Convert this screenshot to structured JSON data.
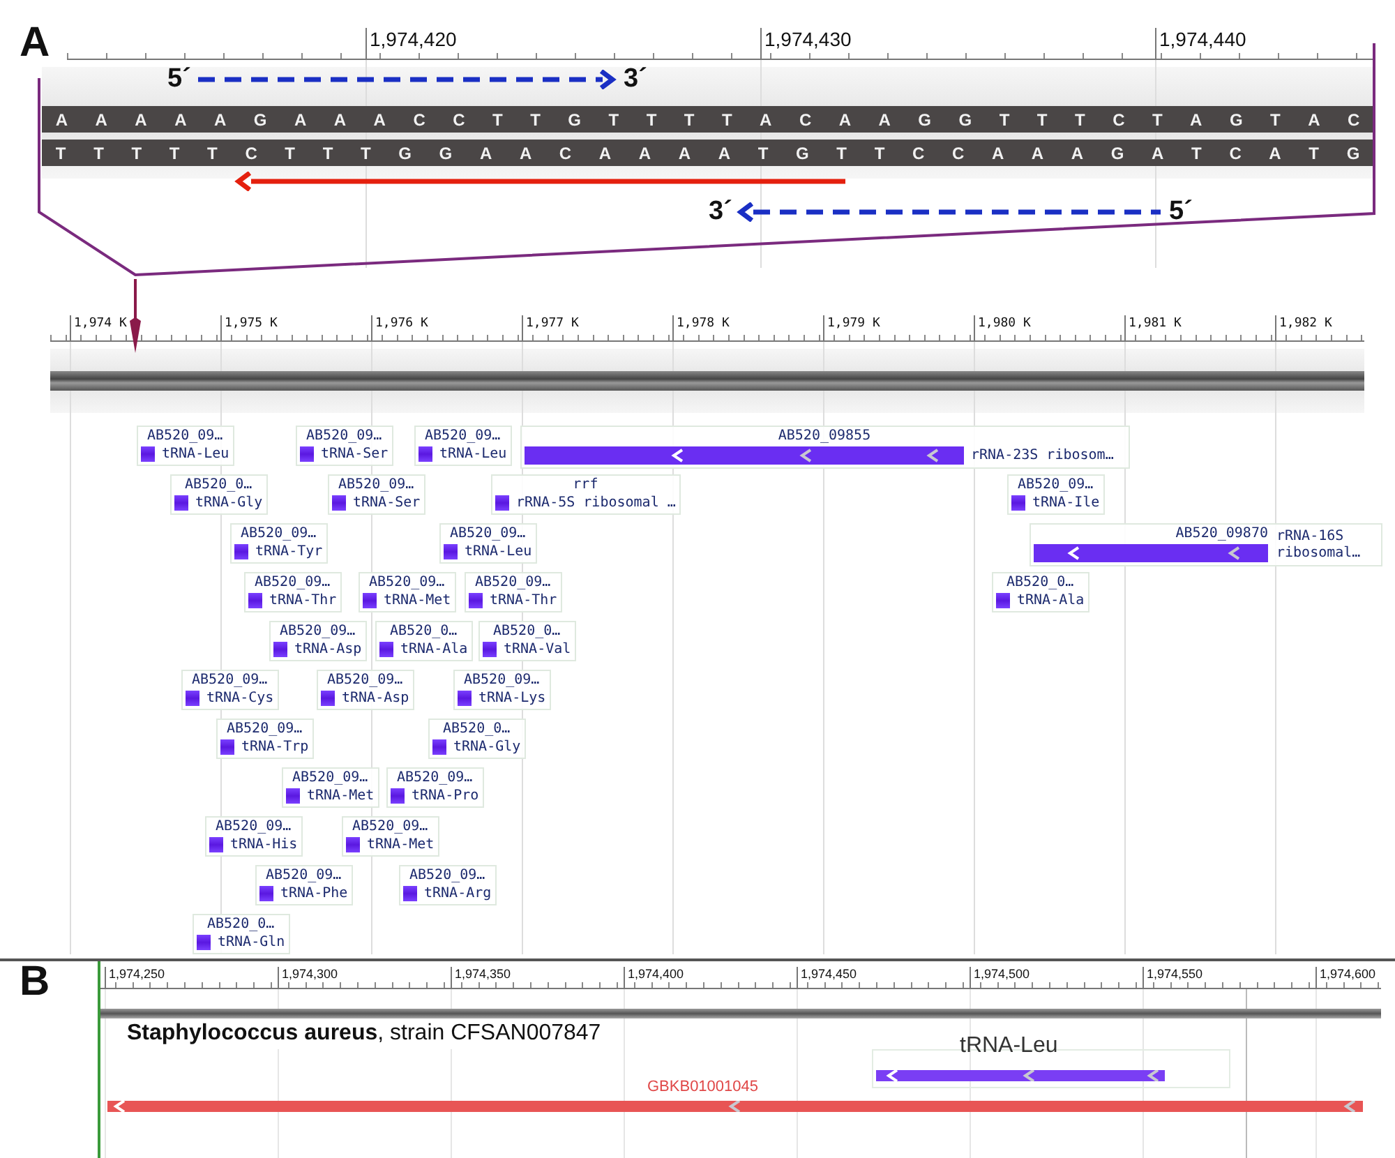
{
  "panel_a": {
    "label": "A",
    "ruler": {
      "ticks": [
        "1,974,420",
        "1,974,430",
        "1,974,440"
      ]
    },
    "primers": [
      {
        "kind": "dashed",
        "reverse": false,
        "start_label": "5´",
        "end_label": "3´"
      },
      {
        "kind": "solid",
        "reverse": true
      },
      {
        "kind": "dashed",
        "reverse": true,
        "start_label": "5´",
        "end_label": "3´"
      }
    ],
    "sequence": {
      "forward": [
        "A",
        "A",
        "A",
        "A",
        "A",
        "G",
        "A",
        "A",
        "A",
        "C",
        "C",
        "T",
        "T",
        "G",
        "T",
        "T",
        "T",
        "T",
        "A",
        "C",
        "A",
        "A",
        "G",
        "G",
        "T",
        "T",
        "T",
        "C",
        "T",
        "A",
        "G",
        "T",
        "A",
        "C"
      ],
      "reverse": [
        "T",
        "T",
        "T",
        "T",
        "T",
        "C",
        "T",
        "T",
        "T",
        "G",
        "G",
        "A",
        "A",
        "C",
        "A",
        "A",
        "A",
        "A",
        "T",
        "G",
        "T",
        "T",
        "C",
        "C",
        "A",
        "A",
        "A",
        "G",
        "A",
        "T",
        "C",
        "A",
        "T",
        "G"
      ]
    },
    "map_ruler": {
      "ticks": [
        "1,974 K",
        "1,975 K",
        "1,976 K",
        "1,977 K",
        "1,978 K",
        "1,979 K",
        "1,980 K",
        "1,981 K",
        "1,982 K"
      ]
    },
    "features": [
      {
        "kind": "small",
        "locus": "AB520_09…",
        "product": "tRNA-Leu"
      },
      {
        "kind": "small",
        "locus": "AB520_09…",
        "product": "tRNA-Ser"
      },
      {
        "kind": "small",
        "locus": "AB520_09…",
        "product": "tRNA-Leu"
      },
      {
        "kind": "bar",
        "locus": "AB520_09855",
        "product": "rRNA-23S ribosom…"
      },
      {
        "kind": "small",
        "locus": "AB520_0…",
        "product": "tRNA-Gly"
      },
      {
        "kind": "small",
        "locus": "AB520_09…",
        "product": "tRNA-Ser"
      },
      {
        "kind": "small",
        "locus": "rrf",
        "product": "rRNA-5S ribosomal …"
      },
      {
        "kind": "small",
        "locus": "AB520_09…",
        "product": "tRNA-Ile"
      },
      {
        "kind": "small",
        "locus": "AB520_09…",
        "product": "tRNA-Tyr"
      },
      {
        "kind": "small",
        "locus": "AB520_09…",
        "product": "tRNA-Leu"
      },
      {
        "kind": "bar_wrap",
        "locus": "AB520_09870",
        "product": "rRNA-16S ribosomal…"
      },
      {
        "kind": "small",
        "locus": "AB520_09…",
        "product": "tRNA-Thr"
      },
      {
        "kind": "small",
        "locus": "AB520_09…",
        "product": "tRNA-Met"
      },
      {
        "kind": "small",
        "locus": "AB520_09…",
        "product": "tRNA-Thr"
      },
      {
        "kind": "small",
        "locus": "AB520_0…",
        "product": "tRNA-Ala"
      },
      {
        "kind": "small",
        "locus": "AB520_09…",
        "product": "tRNA-Asp"
      },
      {
        "kind": "small",
        "locus": "AB520_0…",
        "product": "tRNA-Ala"
      },
      {
        "kind": "small",
        "locus": "AB520_0…",
        "product": "tRNA-Val"
      },
      {
        "kind": "small",
        "locus": "AB520_09…",
        "product": "tRNA-Cys"
      },
      {
        "kind": "small",
        "locus": "AB520_09…",
        "product": "tRNA-Asp"
      },
      {
        "kind": "small",
        "locus": "AB520_09…",
        "product": "tRNA-Lys"
      },
      {
        "kind": "small",
        "locus": "AB520_09…",
        "product": "tRNA-Trp"
      },
      {
        "kind": "small",
        "locus": "AB520_0…",
        "product": "tRNA-Gly"
      },
      {
        "kind": "small",
        "locus": "AB520_09…",
        "product": "tRNA-Met"
      },
      {
        "kind": "small",
        "locus": "AB520_09…",
        "product": "tRNA-Pro"
      },
      {
        "kind": "small",
        "locus": "AB520_09…",
        "product": "tRNA-His"
      },
      {
        "kind": "small",
        "locus": "AB520_09…",
        "product": "tRNA-Met"
      },
      {
        "kind": "small",
        "locus": "AB520_09…",
        "product": "tRNA-Phe"
      },
      {
        "kind": "small",
        "locus": "AB520_09…",
        "product": "tRNA-Arg"
      },
      {
        "kind": "small",
        "locus": "AB520_0…",
        "product": "tRNA-Gln"
      }
    ]
  },
  "panel_b": {
    "label": "B",
    "ruler": {
      "ticks": [
        "1,974,250",
        "1,974,300",
        "1,974,350",
        "1,974,400",
        "1,974,450",
        "1,974,500",
        "1,974,550",
        "1,974,600"
      ]
    },
    "organism": "**Staphylococcus aureus**, strain CFSAN007847",
    "feature": {
      "product": "tRNA-Leu"
    },
    "contig": {
      "name": "GBKB01001045"
    }
  }
}
